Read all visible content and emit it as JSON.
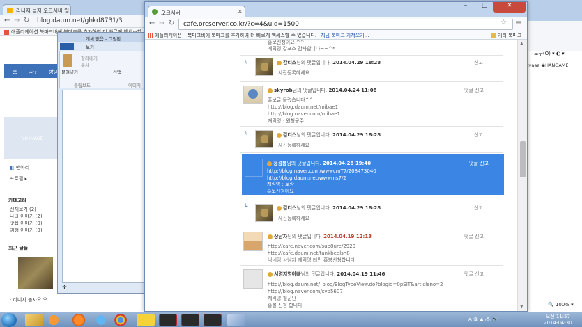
{
  "bg_blog": {
    "tab_title": "리니지 놀자 오크서버 일",
    "url": "blog.daum.net/ghkd8731/3",
    "bookmarks_text": "애플리케이션   북마크바에 북마크를 추가하여 더 빠르게 액세스할 수",
    "nav_items": [
      "홈",
      "사진",
      "방명"
    ],
    "no_image": "NO IMAGE",
    "mynews": "맨아리",
    "profile": "프로필 ▸",
    "category_title": "카테고리",
    "categories": [
      "전체보기 (2)",
      "나의 이야기 (2)",
      "맛집 이야기 (0)",
      "여행 이야기 (0)"
    ],
    "recent_title": "최근 글들",
    "recent_post": "· 리니지 놀자요 오.."
  },
  "explorer": {
    "title": "개체 없음 - 그림판",
    "ribbon_tab": "보기",
    "paste": "붙여넣기",
    "cut": "잘라내기",
    "copy": "복사",
    "select": "선택",
    "clipboard": "클립보드",
    "image": "이미지"
  },
  "rt_portal": {
    "menu": "도구(O) ▾  ◐ ▾",
    "logos": "tvaaa  ◉HANGAME",
    "zoom": "🔍 100%  ▾"
  },
  "main": {
    "tab_title": "오크서버",
    "url": "cafe.orcserver.co.kr/?c=4&uid=1500",
    "bookmarks_apps": "애플리케이션",
    "bookmarks_hint": "북마크바에 북마크를 추가하여 더 빠르게 액세스할 수 있습니다.",
    "bookmarks_link": "지금 북마크 가져오기...",
    "other_bookmarks": "기타 북마크",
    "top_text_1": "홍보신청이요 ^^",
    "top_text_2": "계획명:갑포스 감사합니다~~^*",
    "comments": [
      {
        "user": "감티스",
        "suffix": "님의 댓글입니다.",
        "date": "2014.04.29 18:28",
        "body": "사진등록하세요",
        "actions": "신고"
      },
      {
        "user": "skyrob",
        "suffix": "님의 댓글입니다.",
        "date": "2014.04.24 11:08",
        "body": "홍보글 올렸습니다^^\nhttp://blog.daum.net/mibae1\nhttp://blog.naver.com/mibae1\n캐릭명 : 원형공주",
        "actions": "댓글  신고"
      },
      {
        "user": "감티스",
        "suffix": "님의 댓글입니다.",
        "date": "2014.04.29 18:28",
        "body": "사진등록하세요",
        "actions": "신고"
      },
      {
        "user": "정성봉",
        "suffix": "님의 댓글입니다.",
        "date": "2014.04.28 19:40",
        "body": "http://blog.naver.com/wwwcmT7/208473040\nhttp://blog.daum.net/wwwms7/2\n캐릭명 : 로랑\n홍보신청이요",
        "actions": "댓글  신고"
      },
      {
        "user": "감티스",
        "suffix": "님의 댓글입니다.",
        "date": "2014.04.29 18:28",
        "body": "사진등록하세요",
        "actions": "신고"
      },
      {
        "user": "상남자",
        "suffix": "님의 댓글입니다.",
        "date": "2014.04.19 12:13",
        "body": "http://cafe.naver.com/sub8ure/2923\nhttp://cafe.daum.net/tankbeelsh8\n닉네임:상남자 캐릭명:터민 홍봉신청합니다",
        "actions": "댓글  신고"
      },
      {
        "user": "서영지영아빠",
        "suffix": "님의 댓글입니다.",
        "date": "2014.04.19 11:46",
        "body": "http://blog.daum.net/_blog/BlogTypeView.do?blogid=0pSIT&articleno=2\nhttp://blog.naver.com/svb5607\n캐릭명:철군단\n홍볼 신청 합니다",
        "actions": "댓글  신고"
      }
    ]
  },
  "taskbar": {
    "tray": "A 漢 ▲ 🖧 🔊",
    "time": "오전 11:57",
    "date": "2014-04-30"
  }
}
